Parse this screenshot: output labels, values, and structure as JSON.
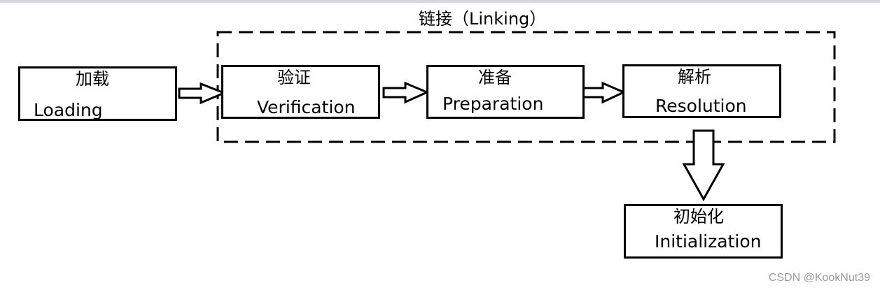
{
  "linking": {
    "title": "链接（Linking）"
  },
  "stages": {
    "loading": {
      "zh": "加载",
      "en": "Loading"
    },
    "verification": {
      "zh": "验证",
      "en": "Verification"
    },
    "preparation": {
      "zh": "准备",
      "en": "Preparation"
    },
    "resolution": {
      "zh": "解析",
      "en": "Resolution"
    },
    "initialization": {
      "zh": "初始化",
      "en": "Initialization"
    }
  },
  "watermark": "CSDN @KookNut39",
  "colors": {
    "stroke": "#000000",
    "background": "#ffffff",
    "watermark": "#9a9a9a"
  }
}
